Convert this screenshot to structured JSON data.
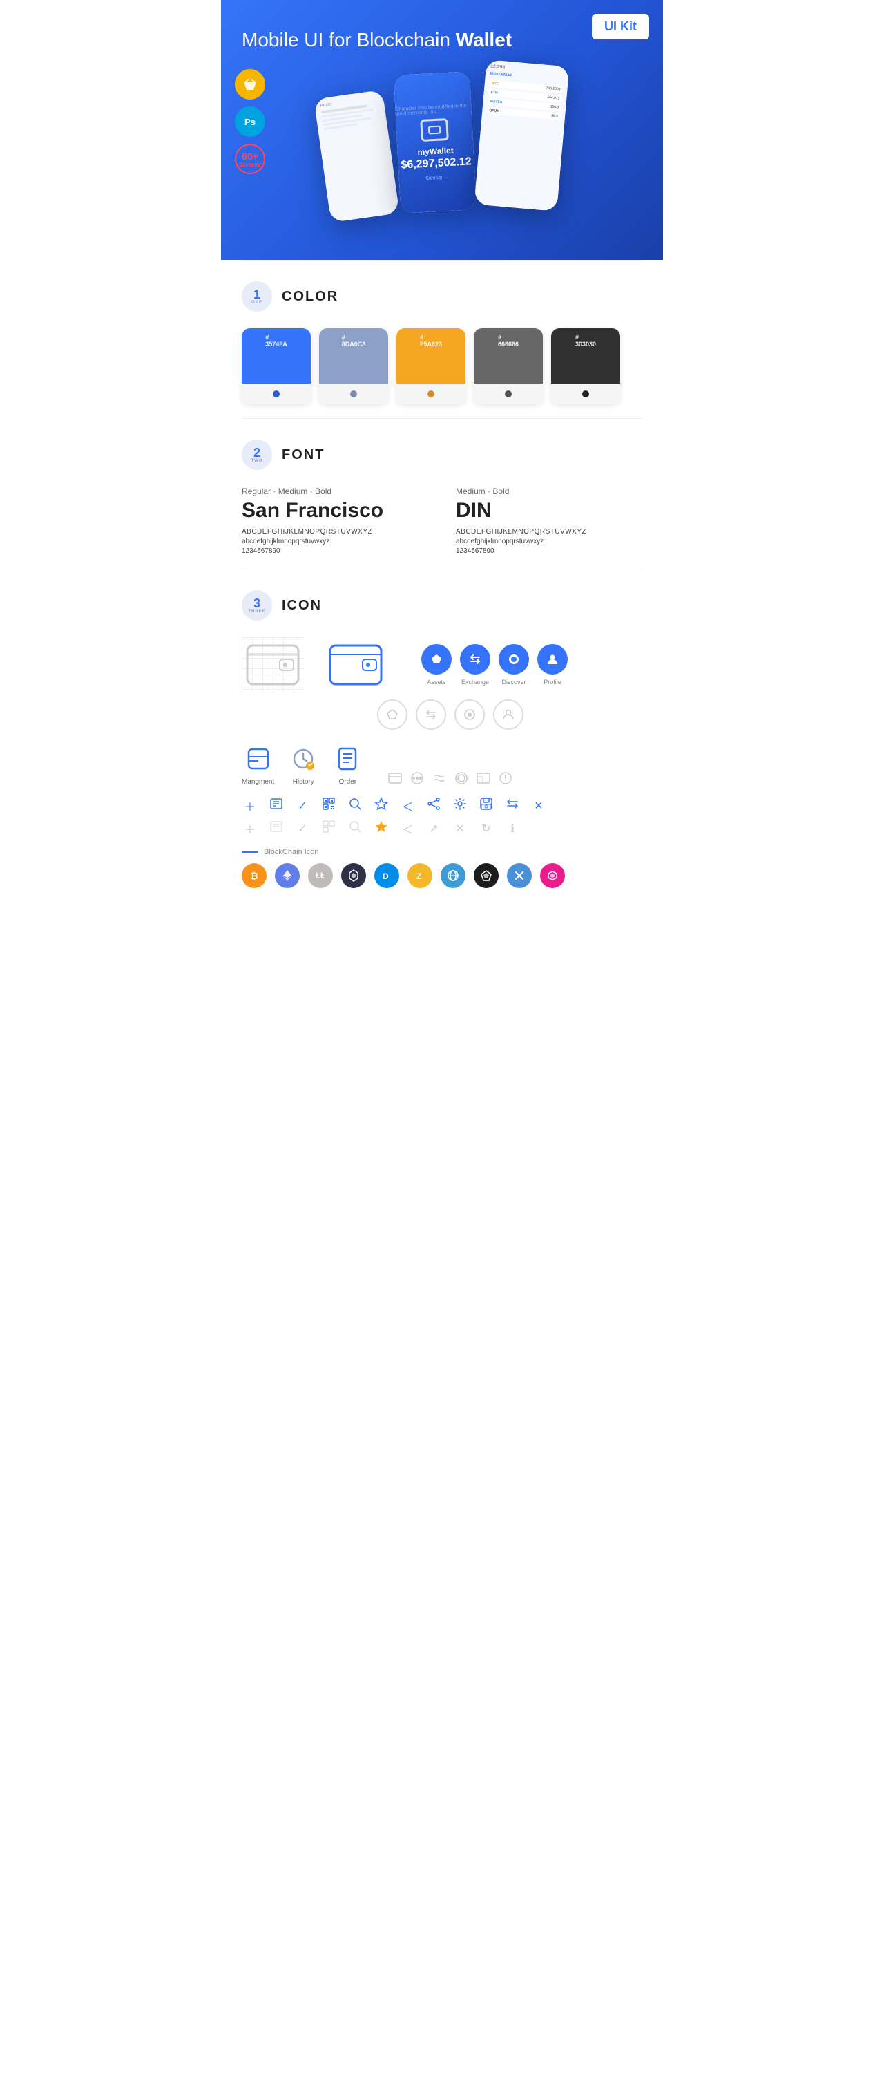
{
  "hero": {
    "title": "Mobile UI for Blockchain ",
    "title_bold": "Wallet",
    "badge": "UI Kit",
    "badge_sketch": "S",
    "badge_ps": "Ps",
    "screens_count": "60+",
    "screens_label": "Screens"
  },
  "sections": {
    "color": {
      "number": "1",
      "label": "ONE",
      "heading": "COLOR",
      "swatches": [
        {
          "hex": "#3574FA",
          "code": "3574FA",
          "dot": "#2a5fd4"
        },
        {
          "hex": "#8DA0C8",
          "code": "8DA0C8",
          "dot": "#7b8fb5"
        },
        {
          "hex": "#F5A623",
          "code": "F5A623",
          "dot": "#d4902a"
        },
        {
          "hex": "#666666",
          "code": "666666",
          "dot": "#555"
        },
        {
          "hex": "#303030",
          "code": "303030",
          "dot": "#222"
        }
      ]
    },
    "font": {
      "number": "2",
      "label": "TWO",
      "heading": "FONT",
      "fonts": [
        {
          "style": "Regular · Medium · Bold",
          "name": "San Francisco",
          "upper": "ABCDEFGHIJKLMNOPQRSTUVWXYZ",
          "lower": "abcdefghijklmnopqrstuvwxyz",
          "nums": "1234567890"
        },
        {
          "style": "Medium · Bold",
          "name": "DIN",
          "upper": "ABCDEFGHIJKLMNOPQRSTUVWXYZ",
          "lower": "abcdefghijklmnopqrstuvwxyz",
          "nums": "1234567890"
        }
      ]
    },
    "icon": {
      "number": "3",
      "label": "THREE",
      "heading": "ICON",
      "nav_icons": [
        {
          "label": "Assets",
          "symbol": "◆"
        },
        {
          "label": "Exchange",
          "symbol": "⇄"
        },
        {
          "label": "Discover",
          "symbol": "●"
        },
        {
          "label": "Profile",
          "symbol": "👤"
        }
      ],
      "mgmt_icons": [
        {
          "label": "Mangment",
          "symbol": "⊟"
        },
        {
          "label": "History",
          "symbol": "⏱"
        },
        {
          "label": "Order",
          "symbol": "📋"
        }
      ],
      "blockchain_label": "BlockChain Icon",
      "crypto": [
        {
          "symbol": "₿",
          "color": "#F7931A",
          "name": "Bitcoin"
        },
        {
          "symbol": "Ξ",
          "color": "#627EEA",
          "name": "Ethereum"
        },
        {
          "symbol": "Ł",
          "color": "#A6A9AA",
          "name": "Litecoin"
        },
        {
          "symbol": "◆",
          "color": "#1C1C1C",
          "name": "Qtum"
        },
        {
          "symbol": "D",
          "color": "#008CE7",
          "name": "Dash"
        },
        {
          "symbol": "Z",
          "color": "#F4B728",
          "name": "Zcash"
        },
        {
          "symbol": "◈",
          "color": "#3D9BD5",
          "name": "EOS"
        },
        {
          "symbol": "▲",
          "color": "#1B1B1B",
          "name": "Ark"
        },
        {
          "symbol": "◇",
          "color": "#2E3148",
          "name": "Nano"
        },
        {
          "symbol": "∞",
          "color": "#e91e8c",
          "name": "Matic"
        }
      ]
    }
  }
}
